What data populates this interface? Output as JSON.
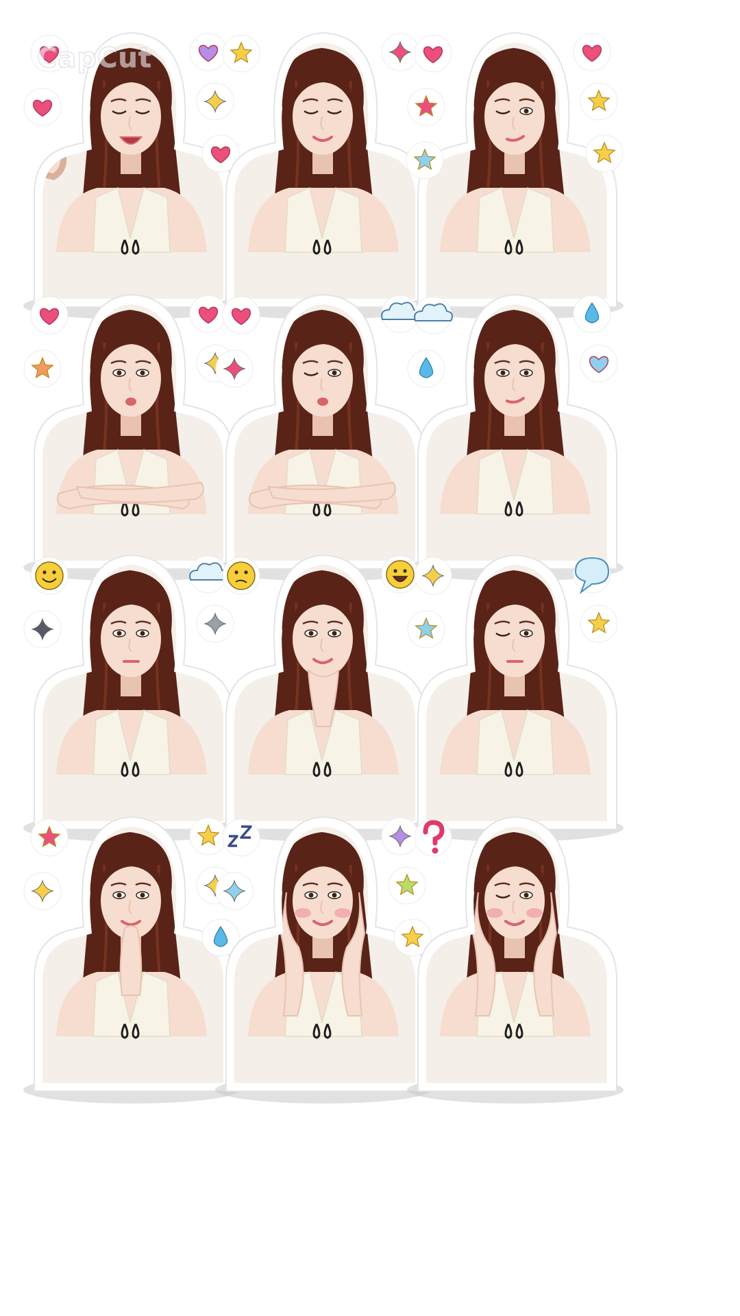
{
  "watermark": {
    "text": "CapCut"
  },
  "stickers": [
    {
      "pose": "waving",
      "eyes": "open-smile",
      "mouth": "laugh",
      "hands": "wave",
      "decor": [
        "heart-pink",
        "heart-purple",
        "heart-pink",
        "sparkle-yellow",
        "heart-pink"
      ]
    },
    {
      "pose": "smile",
      "eyes": "closed-smile",
      "mouth": "smile",
      "hands": "none",
      "decor": [
        "star-yellow",
        "sparkle-pink"
      ]
    },
    {
      "pose": "wink",
      "eyes": "wink",
      "mouth": "smirk",
      "hands": "none",
      "decor": [
        "heart-pink",
        "heart-pink",
        "star-pink",
        "star-yellow",
        "star-yellow",
        "star-blue"
      ]
    },
    {
      "pose": "pout-arms-crossed",
      "eyes": "open",
      "mouth": "pout",
      "hands": "arms-crossed",
      "decor": [
        "heart-pink",
        "heart-pink",
        "star-orange",
        "sparkle-yellow"
      ]
    },
    {
      "pose": "pout-arms-crossed-wink",
      "eyes": "wink",
      "mouth": "pout",
      "hands": "arms-crossed",
      "decor": [
        "heart-pink",
        "cloud-blue",
        "sparkle-pink"
      ]
    },
    {
      "pose": "smirk",
      "eyes": "open",
      "mouth": "smirk",
      "hands": "none",
      "decor": [
        "cloud-blue",
        "drop-blue",
        "drop-blue",
        "heart-blue"
      ]
    },
    {
      "pose": "neutral",
      "eyes": "open",
      "mouth": "neutral",
      "hands": "none",
      "decor": [
        "emoji-smile",
        "cloud-blue",
        "sparkle-dark",
        "sparkle-gray"
      ]
    },
    {
      "pose": "chin-on-hands",
      "eyes": "open",
      "mouth": "smile",
      "hands": "chin",
      "decor": [
        "emoji-confused",
        "emoji-grin"
      ]
    },
    {
      "pose": "squint",
      "eyes": "wink",
      "mouth": "neutral",
      "hands": "none",
      "decor": [
        "sparkle-yellow",
        "speech-blue",
        "star-blue",
        "star-yellow"
      ]
    },
    {
      "pose": "praying",
      "eyes": "open",
      "mouth": "smile",
      "hands": "pray",
      "decor": [
        "star-pink",
        "star-yellow",
        "sparkle-yellow",
        "sparkle-yellow",
        "drop-blue"
      ]
    },
    {
      "pose": "cheeks-in-hands",
      "eyes": "open",
      "mouth": "smile",
      "hands": "cheeks",
      "decor": [
        "zzz-navy",
        "sparkle-purple",
        "sparkle-blue",
        "star-green",
        "star-yellow"
      ]
    },
    {
      "pose": "cheeks-in-hands-wink",
      "eyes": "wink",
      "mouth": "smile",
      "hands": "cheeks",
      "decor": [
        "question-pink"
      ]
    }
  ],
  "colors": {
    "hair": "#5a2318",
    "hair_highlight": "#8a3c26",
    "skin": "#f6ddd0",
    "skin_shade": "#e8c3b0",
    "top": "#f7f3e6",
    "lips": "#d9646a",
    "shadow": "#c9c9c9",
    "pink": "#ec4f7c",
    "yellow": "#f6cf48",
    "blue": "#8fd0ee",
    "purple": "#b58ee6"
  }
}
